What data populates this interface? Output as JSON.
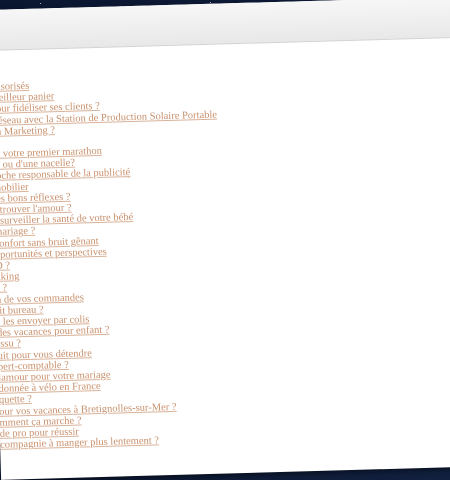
{
  "links_group_1": [
    "onsorisés",
    "meilleur panier",
    "pour fidéliser ses clients ?",
    "Réseau avec la Station de Production Solaire Portable",
    "ch Marketing ?"
  ],
  "links_group_2": [
    "er votre premier marathon",
    "le ou d'une nacelle?",
    "roche responsable de la publicité",
    "mobilier",
    "les bons réflexes ?",
    "r trouver l'amour ?",
    "r surveiller la santé de votre bébé",
    "mariage ?",
    "confort sans bruit gênant",
    "pportunités et perspectives",
    "D ?",
    "nking",
    "s ?",
    "n de vos commandes",
    "tit bureau ?",
    "r les envoyer par colis",
    "des vacances pour enfant ?",
    "issu ?",
    "uit pour vous détendre",
    "pert-comptable ?",
    "lamour pour votre mariage",
    "donnée à vélo en France",
    "quette ?",
    "our vos vacances à Bretignolles-sur-Mer ?",
    "mment ça marche ?",
    "de pro pour réussir",
    "compagnie à manger plus lentement ?"
  ]
}
